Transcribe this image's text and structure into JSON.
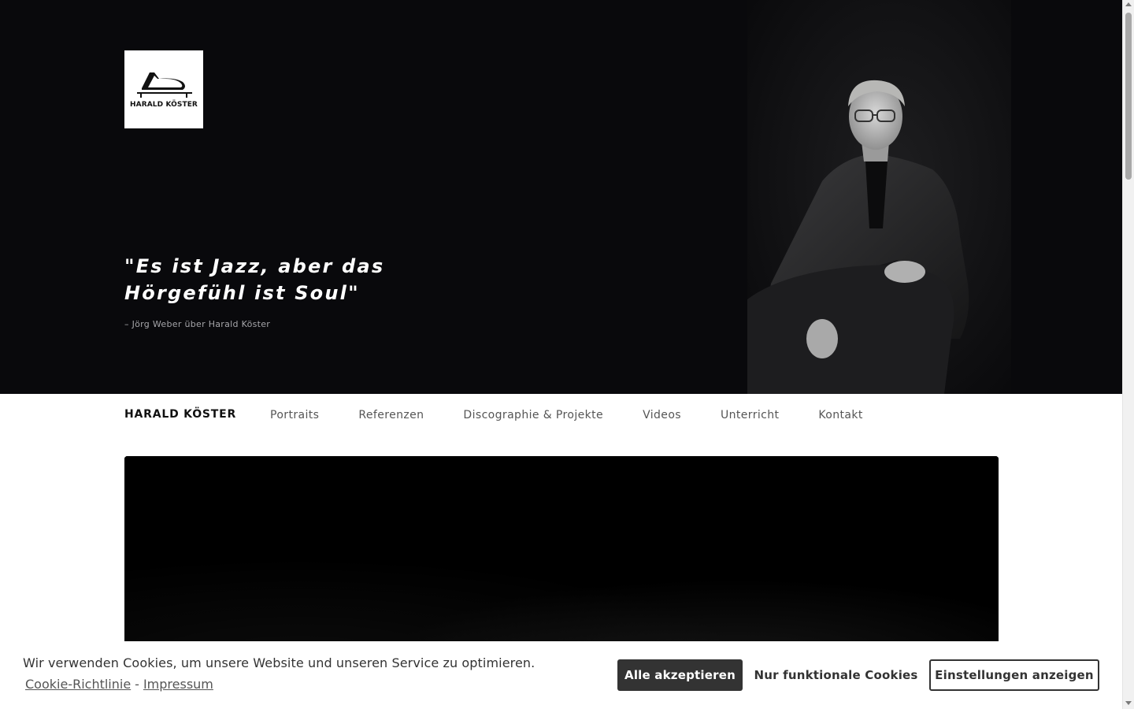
{
  "hero": {
    "logo": {
      "text": "HARALD KÖSTER",
      "icon": "grand-piano-icon"
    },
    "quote": "\"Es ist Jazz, aber das Hörgefühl ist Soul\"",
    "quote_attribution": "– Jörg Weber über Harald Köster"
  },
  "nav": {
    "brand": "HARALD KÖSTER",
    "items": [
      {
        "label": "Portraits"
      },
      {
        "label": "Referenzen"
      },
      {
        "label": "Discographie & Projekte"
      },
      {
        "label": "Videos"
      },
      {
        "label": "Unterricht"
      },
      {
        "label": "Kontakt"
      }
    ]
  },
  "cookie_banner": {
    "message": "Wir verwenden Cookies, um unsere Website und unseren Service zu optimieren.",
    "link_policy": "Cookie-Richtlinie",
    "separator": "-",
    "link_imprint": "Impressum",
    "accept_all_label": "Alle akzeptieren",
    "functional_only_label": "Nur funktionale Cookies",
    "show_settings_label": "Einstellungen anzeigen"
  },
  "colors": {
    "hero_background": "#09090c",
    "accept_button": "#333333",
    "text_dark": "#111111"
  }
}
